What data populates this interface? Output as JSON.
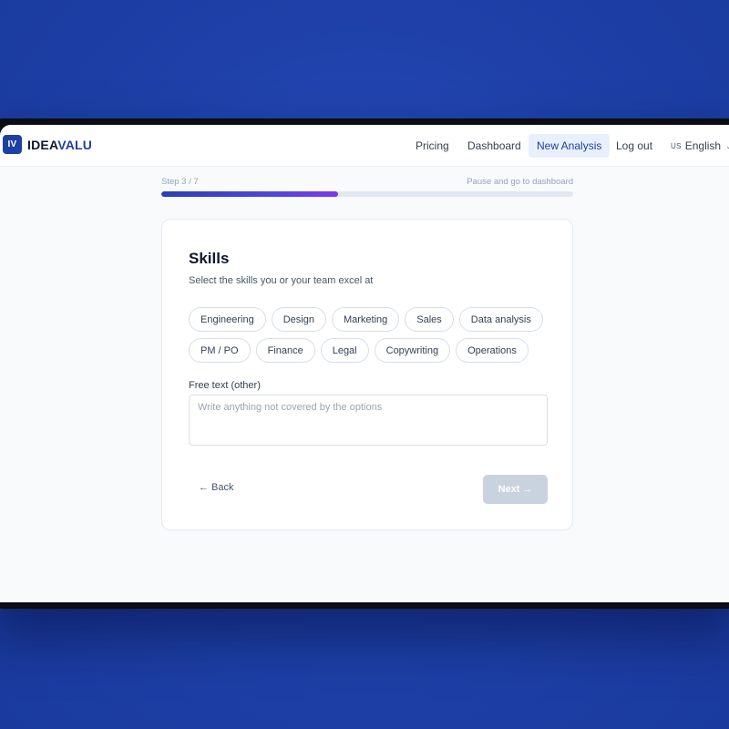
{
  "brand": {
    "mark": "IV",
    "name_part1": "IDEA",
    "name_part2": "VALU",
    "accent_color": "#1e3fa4"
  },
  "nav": {
    "items": [
      {
        "label": "Pricing",
        "active": false
      },
      {
        "label": "Dashboard",
        "active": false
      },
      {
        "label": "New Analysis",
        "active": true
      },
      {
        "label": "Log out",
        "active": false
      }
    ],
    "language": {
      "flag": "US",
      "label": "English",
      "icon": "chevron-down-icon"
    }
  },
  "progress": {
    "step_label": "Step 3 / 7",
    "pause_link": "Pause and go to dashboard",
    "fraction": 0.43,
    "gradient": [
      "#2a3fb2",
      "#7c3aed"
    ]
  },
  "form": {
    "title": "Skills",
    "subtitle": "Select the skills you or your team excel at",
    "options": [
      "Engineering",
      "Design",
      "Marketing",
      "Sales",
      "Data analysis",
      "PM / PO",
      "Finance",
      "Legal",
      "Copywriting",
      "Operations"
    ],
    "free_text_label": "Free text (other)",
    "free_text_placeholder": "Write anything not covered by the options",
    "free_text_value": "",
    "back_label": "Back",
    "back_icon": "←",
    "next_label": "Next",
    "next_icon": "→",
    "next_disabled": true
  }
}
